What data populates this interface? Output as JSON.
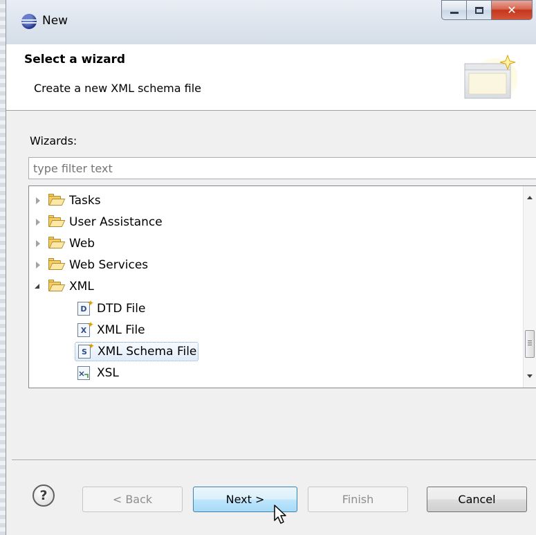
{
  "window": {
    "title": "New"
  },
  "header": {
    "title": "Select a wizard",
    "description": "Create a new XML schema file"
  },
  "wizards_label": "Wizards:",
  "filter": {
    "value": "",
    "placeholder": "type filter text"
  },
  "tree": {
    "items": [
      {
        "label": "Tasks",
        "type": "folder",
        "expanded": false
      },
      {
        "label": "User Assistance",
        "type": "folder",
        "expanded": false
      },
      {
        "label": "Web",
        "type": "folder",
        "expanded": false
      },
      {
        "label": "Web Services",
        "type": "folder",
        "expanded": false
      },
      {
        "label": "XML",
        "type": "folder",
        "expanded": true
      },
      {
        "label": "DTD File",
        "type": "file",
        "icon_letter": "D"
      },
      {
        "label": "XML File",
        "type": "file",
        "icon_letter": "X"
      },
      {
        "label": "XML Schema File",
        "type": "file",
        "icon_letter": "S",
        "selected": true
      },
      {
        "label": "XSL",
        "type": "file",
        "icon_letter": ""
      }
    ]
  },
  "buttons": {
    "help": "?",
    "back": "< Back",
    "next": "Next >",
    "finish": "Finish",
    "cancel": "Cancel"
  },
  "colors": {
    "selection_border": "#7da2ce",
    "next_button_border": "#3c7fb1",
    "close_button": "#c4361c"
  }
}
